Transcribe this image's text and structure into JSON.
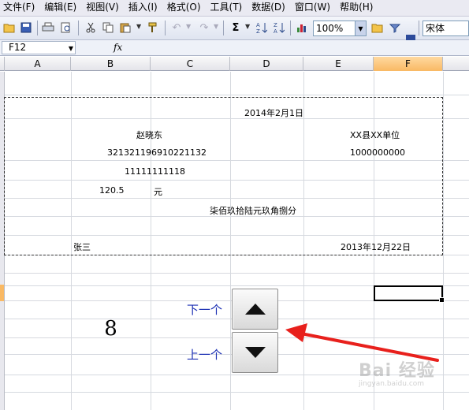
{
  "menu": [
    "文件(F)",
    "编辑(E)",
    "视图(V)",
    "插入(I)",
    "格式(O)",
    "工具(T)",
    "数据(D)",
    "窗口(W)",
    "帮助(H)"
  ],
  "toolbar": {
    "zoom": "100%",
    "font": "宋体"
  },
  "formula_bar": {
    "name_box": "F12",
    "fx": "fx"
  },
  "columns": [
    "A",
    "B",
    "C",
    "D",
    "E",
    "F"
  ],
  "active_column": "F",
  "cells": {
    "date_header": "2014年2月1日",
    "name": "赵晓东",
    "company": "XX县XX单位",
    "id_number": "321321196910221132",
    "account": "1000000000",
    "phone": "11111111118",
    "amount": "120.5",
    "currency_unit": "元",
    "amount_words": "柒佰玖拾陆元玖角捌分",
    "signer": "张三",
    "sign_date": "2013年12月22日"
  },
  "counter_value": "8",
  "spinner": {
    "next_label": "下一个",
    "prev_label": "上一个"
  },
  "watermark": {
    "text": "Bai 经验",
    "sub": "jingyan.baidu.com"
  },
  "colors": {
    "label_blue": "#1b2fb3",
    "arrow_red": "#e8201c",
    "active_header": "#f9b964"
  }
}
